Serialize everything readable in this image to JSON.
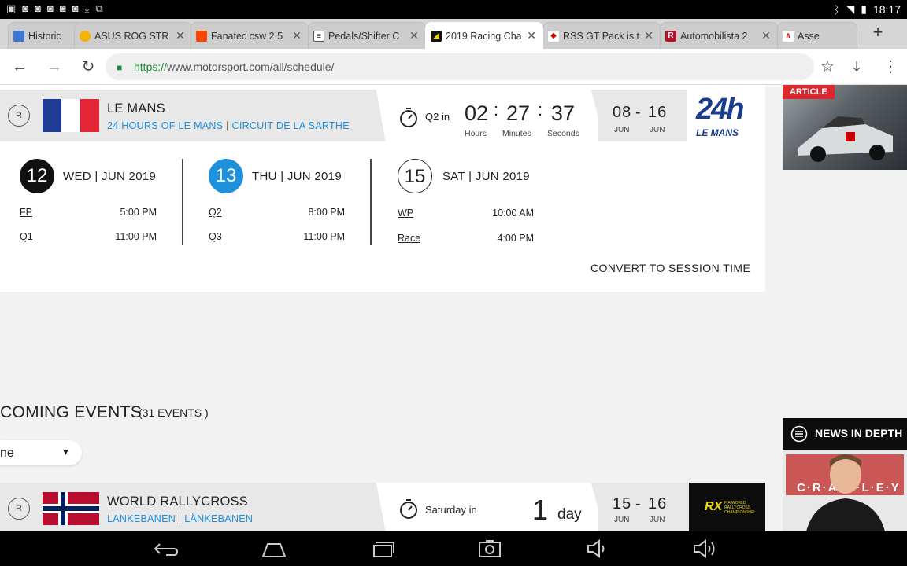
{
  "status": {
    "time": "18:17"
  },
  "tabs": [
    {
      "label": "Historic",
      "fav_color": "#3c78d8",
      "fav_text": ""
    },
    {
      "label": "ASUS ROG STR",
      "fav_color": "#f4b400",
      "fav_text": ""
    },
    {
      "label": "Fanatec csw 2.5",
      "fav_color": "#ff4500",
      "fav_text": ""
    },
    {
      "label": "Pedals/Shifter C",
      "fav_color": "#222222",
      "fav_text": ""
    },
    {
      "label": "2019 Racing Cha",
      "fav_color": "#111111",
      "fav_text": ""
    },
    {
      "label": "RSS GT Pack is t",
      "fav_color": "#cc0000",
      "fav_text": ""
    },
    {
      "label": "Automobilista 2",
      "fav_color": "#b3122b",
      "fav_text": "R"
    },
    {
      "label": "Asse",
      "fav_color": "#e03030",
      "fav_text": ""
    }
  ],
  "url": {
    "scheme": "https://",
    "rest": "www.motorsport.com/all/schedule/"
  },
  "event1": {
    "badge": "R",
    "name": "LE MANS",
    "sub1": "24 HOURS OF LE MANS",
    "sep": "|",
    "sub2": "CIRCUIT DE LA SARTHE",
    "countdown_label": "Q2 in",
    "hours": "02",
    "minutes": "27",
    "seconds": "37",
    "hours_label": "Hours",
    "minutes_label": "Minutes",
    "seconds_label": "Seconds",
    "date_start": "08",
    "date_dash": "-",
    "date_end": "16",
    "mon_start": "JUN",
    "mon_end": "JUN",
    "logo_top": "24h",
    "logo_bottom": "LE MANS",
    "days": [
      {
        "num": "12",
        "head": "WED | JUN 2019",
        "sessions": [
          {
            "name": "FP",
            "time": "5:00 PM"
          },
          {
            "name": "Q1",
            "time": "11:00 PM"
          }
        ]
      },
      {
        "num": "13",
        "head": "THU | JUN 2019",
        "sessions": [
          {
            "name": "Q2",
            "time": "8:00 PM"
          },
          {
            "name": "Q3",
            "time": "11:00 PM"
          }
        ]
      },
      {
        "num": "15",
        "head": "SAT | JUN 2019",
        "sessions": [
          {
            "name": "WP",
            "time": "10:00 AM"
          },
          {
            "name": "Race",
            "time": "4:00 PM"
          }
        ]
      }
    ],
    "convert": "CONVERT TO SESSION TIME"
  },
  "article_badge": "ARTICLE",
  "upcoming": {
    "title": "COMING EVENTS",
    "count": "(31 EVENTS )",
    "filter": "ne"
  },
  "event2": {
    "badge": "R",
    "name": "WORLD RALLYCROSS",
    "sub1": "LANKEBANEN",
    "sep": "|",
    "sub2": "LÅNKEBANEN",
    "countdown_label": "Saturday in",
    "big": "1",
    "unit": "day",
    "date_start": "15",
    "date_dash": "-",
    "date_end": "16",
    "mon_start": "JUN",
    "mon_end": "JUN",
    "logo_text": "FIA WORLD RALLYCROSS CHAMPIONSHIP"
  },
  "news": {
    "label": "NEWS IN DEPTH",
    "banner": "C·R·A·W·L·E·Y"
  }
}
